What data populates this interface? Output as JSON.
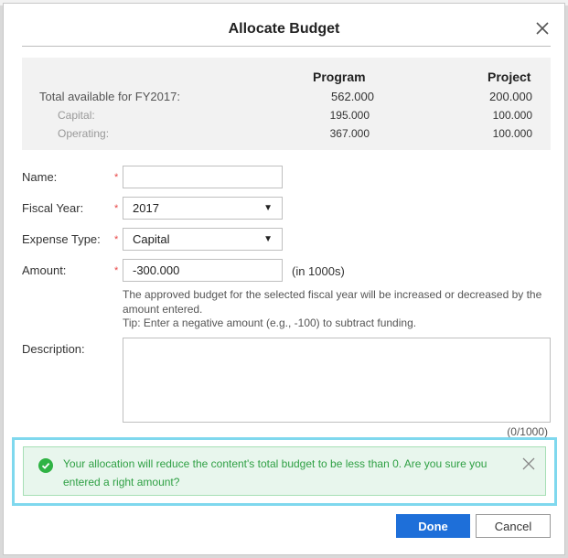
{
  "dialog": {
    "title": "Allocate Budget"
  },
  "summary": {
    "col_program": "Program",
    "col_project": "Project",
    "rows": [
      {
        "label": "Total available for FY2017:",
        "program": "562.000",
        "project": "200.000"
      },
      {
        "label": "Capital:",
        "program": "195.000",
        "project": "100.000"
      },
      {
        "label": "Operating:",
        "program": "367.000",
        "project": "100.000"
      }
    ]
  },
  "form": {
    "name_label": "Name:",
    "name_value": "",
    "fiscal_year_label": "Fiscal Year:",
    "fiscal_year_value": "2017",
    "expense_type_label": "Expense Type:",
    "expense_type_value": "Capital",
    "amount_label": "Amount:",
    "amount_value": "-300.000",
    "amount_unit": "(in 1000s)",
    "required_mark": "*",
    "help_line1": "The approved budget for the selected fiscal year will be increased or decreased by the amount entered.",
    "help_line2": "Tip: Enter a negative amount (e.g., -100) to subtract funding.",
    "description_label": "Description:",
    "description_value": "",
    "description_counter": "(0/1000)"
  },
  "alert": {
    "message": "Your allocation will reduce the content's total budget to be less than 0. Are you sure you entered a right amount?",
    "color": "#2fb344"
  },
  "buttons": {
    "done": "Done",
    "cancel": "Cancel"
  },
  "colors": {
    "primary": "#1e6fd9",
    "required": "#e84545",
    "highlight": "#7fd8ee"
  }
}
